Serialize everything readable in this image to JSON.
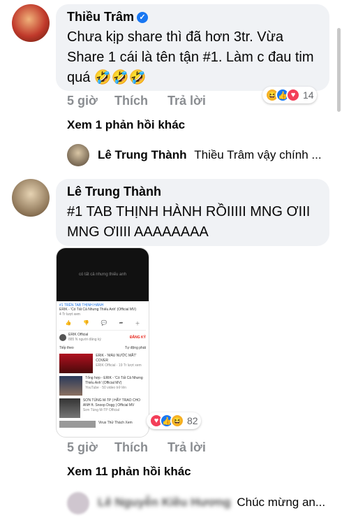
{
  "comment1": {
    "author": "Thiều Trâm",
    "text": "Chưa kịp share thì đã hơn 3tr. Vừa Share 1 cái là tên tận #1. Làm c đau tim quá 🤣🤣🤣",
    "time": "5 giờ",
    "like": "Thích",
    "reply": "Trả lời",
    "reaction_count": "14",
    "view_more": "Xem 1 phản hồi khác"
  },
  "reply1": {
    "author": "Lê Trung Thành",
    "preview": "Thiều Trâm vậy chính ..."
  },
  "comment2": {
    "author": "Lê Trung Thành",
    "text": "#1 TAB THỊNH HÀNH RỒIIIII MNG ƠIII MNG ƠIIII AAAAAAAA",
    "time": "5 giờ",
    "like": "Thích",
    "reply": "Trả lời",
    "reaction_count": "82",
    "view_more": "Xem 11 phản hồi khác"
  },
  "reply2": {
    "author": "Lê Nguyễn Kiều Hương",
    "preview": "Chúc mừng an..."
  },
  "screenshot": {
    "video_title": "có tất cả nhưng thiếu anh",
    "tag": "#1 TRÊN TAB THỊNH HÀNH",
    "title": "ERIK - 'Có Tất Cả Nhưng Thiếu Anh' (Official MV)",
    "views": "4 Tr lượt xem",
    "channel": "ERIK Official",
    "channel_subs": "885 N người đăng ký",
    "subscribe": "ĐĂNG KÝ",
    "up_next": "Tiếp theo",
    "autoplay": "Tự động phát",
    "items": [
      {
        "title": "ERIK - 'MÀU NƯỚC MẮT' COVER",
        "sub": "ERIK Official · 19 Tr lượt xem"
      },
      {
        "title": "Tổng hợp - ERIK - 'Có Tất Cả Nhưng Thiếu Anh' (Official MV)",
        "sub": "YouTube · 50 video trở lên"
      },
      {
        "title": "SƠN TÙNG M-TP | HÃY TRAO CHO ANH ft. Snoop Dogg | Official MV",
        "sub": "Sơn Tùng M-TP Official"
      },
      {
        "title": "Virus Thử Thách Xem",
        "sub": ""
      }
    ]
  },
  "colors": {
    "accent": "#1877f2",
    "bubble": "#f0f2f5",
    "meta": "#8a8d91",
    "haha": "#f7b125",
    "love": "#f33e58"
  }
}
